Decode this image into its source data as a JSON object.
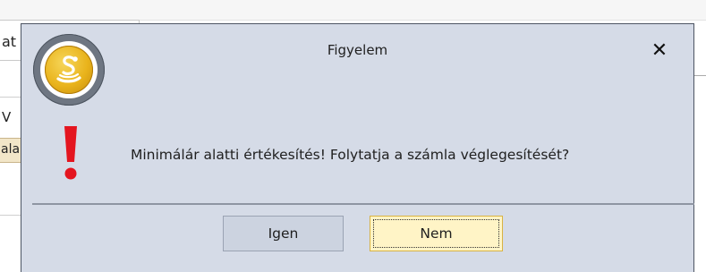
{
  "background": {
    "field_top_fragment": "at",
    "field_mid_fragment": "V",
    "field_low_fragment": "ala"
  },
  "dialog": {
    "title": "Figyelem",
    "close_label": "✕",
    "message": "Minimálár alatti értékesítés! Folytatja a számla véglegesítését?",
    "buttons": {
      "yes": "Igen",
      "no": "Nem"
    },
    "focused_button": "no",
    "icons": {
      "app": "snake-coin-icon",
      "warning": "exclamation-icon"
    },
    "colors": {
      "background": "#d5dbe7",
      "warning": "#e4151f",
      "coin": "#e9b31b",
      "yes_button": "#ccd3e0",
      "no_button": "#fff4c6"
    }
  }
}
